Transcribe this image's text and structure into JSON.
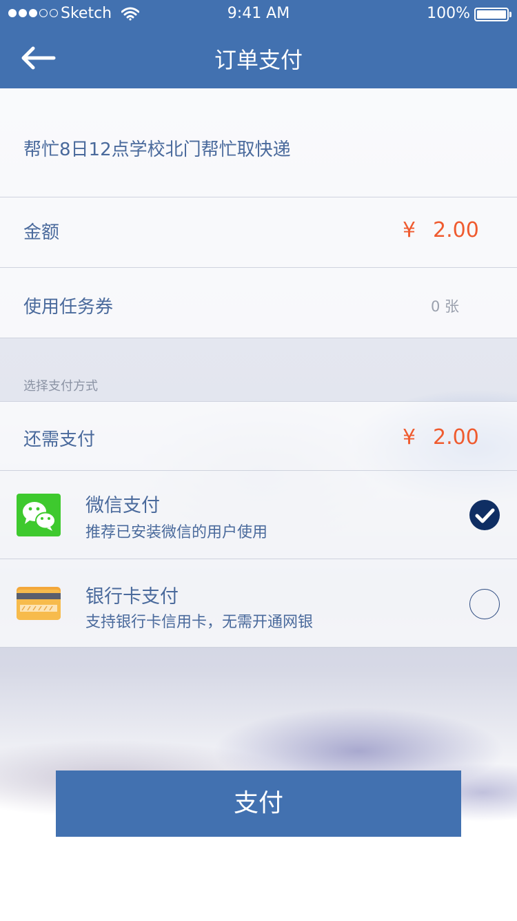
{
  "status_bar": {
    "carrier": "Sketch",
    "time": "9:41 AM",
    "battery": "100%"
  },
  "nav": {
    "title": "订单支付",
    "back_icon": "arrow-left-icon"
  },
  "order": {
    "description": "帮忙8日12点学校北门帮忙取快递"
  },
  "amount": {
    "label": "金额",
    "currency": "¥",
    "value": "2.00"
  },
  "coupon": {
    "label": "使用任务券",
    "value": "0 张"
  },
  "payment_section": {
    "label": "选择支付方式"
  },
  "remaining": {
    "label": "还需支付",
    "currency": "¥",
    "value": "2.00"
  },
  "methods": [
    {
      "name": "微信支付",
      "desc": "推荐已安装微信的用户使用",
      "icon": "wechat-icon",
      "selected": true
    },
    {
      "name": "银行卡支付",
      "desc": "支持银行卡信用卡，无需开通网银",
      "icon": "bank-card-icon",
      "selected": false
    }
  ],
  "pay_button": {
    "label": "支付"
  },
  "colors": {
    "primary": "#4271b0",
    "price": "#ef5b2f",
    "text": "#4a6a9c",
    "check_selected": "#0f2e63",
    "wechat_green": "#3ec92e"
  }
}
